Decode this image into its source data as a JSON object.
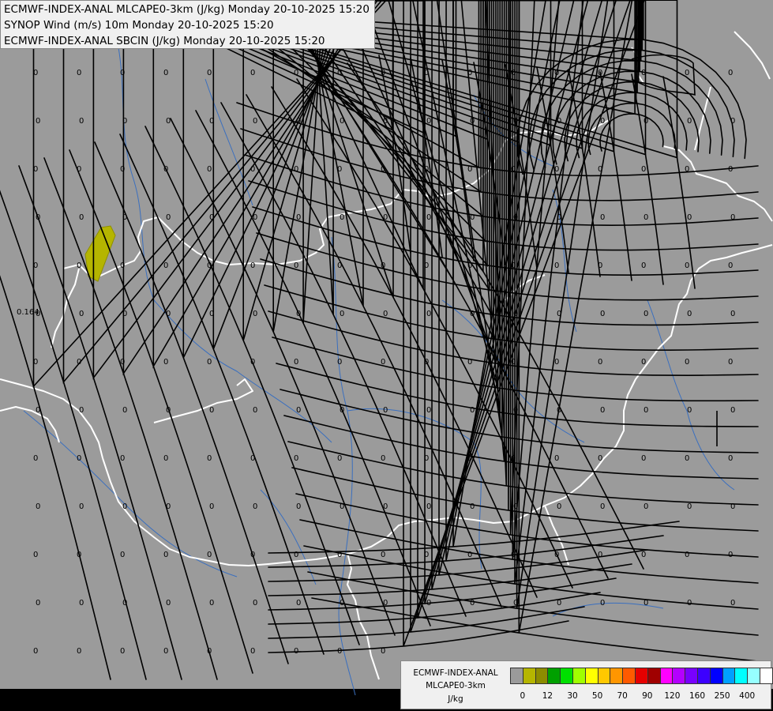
{
  "title_lines": [
    "ECMWF-INDEX-ANAL MLCAPE0-3km (J/kg) Monday 20-10-2025 15:20",
    "SYNOP Wind (m/s) 10m Monday 20-10-2025 15:20",
    "ECMWF-INDEX-ANAL SBCIN (J/kg) Monday 20-10-2025 15:20"
  ],
  "map": {
    "background_color": "#9b9b9b",
    "border_color": "#ffffff",
    "river_color": "#3a6fbf",
    "streamline_color": "#000000",
    "cape_patch_color": "#b5b500",
    "grid_value_label": "0",
    "spot_value_label": "0.164"
  },
  "legend": {
    "lines": [
      "ECMWF-INDEX-ANAL",
      "MLCAPE0-3km",
      "J/kg"
    ],
    "colors": [
      "#9b9b9b",
      "#b5b500",
      "#8c8c00",
      "#00a000",
      "#00e000",
      "#a0ff00",
      "#ffff00",
      "#ffc800",
      "#ff9600",
      "#ff5a00",
      "#e60000",
      "#a00000",
      "#ff00ff",
      "#b400ff",
      "#7800ff",
      "#3c00ff",
      "#0000ff",
      "#00a0ff",
      "#00ffff",
      "#96ffff",
      "#ffffff"
    ],
    "tick_labels": [
      "0",
      "12",
      "30",
      "50",
      "70",
      "90",
      "120",
      "160",
      "250",
      "400"
    ]
  }
}
